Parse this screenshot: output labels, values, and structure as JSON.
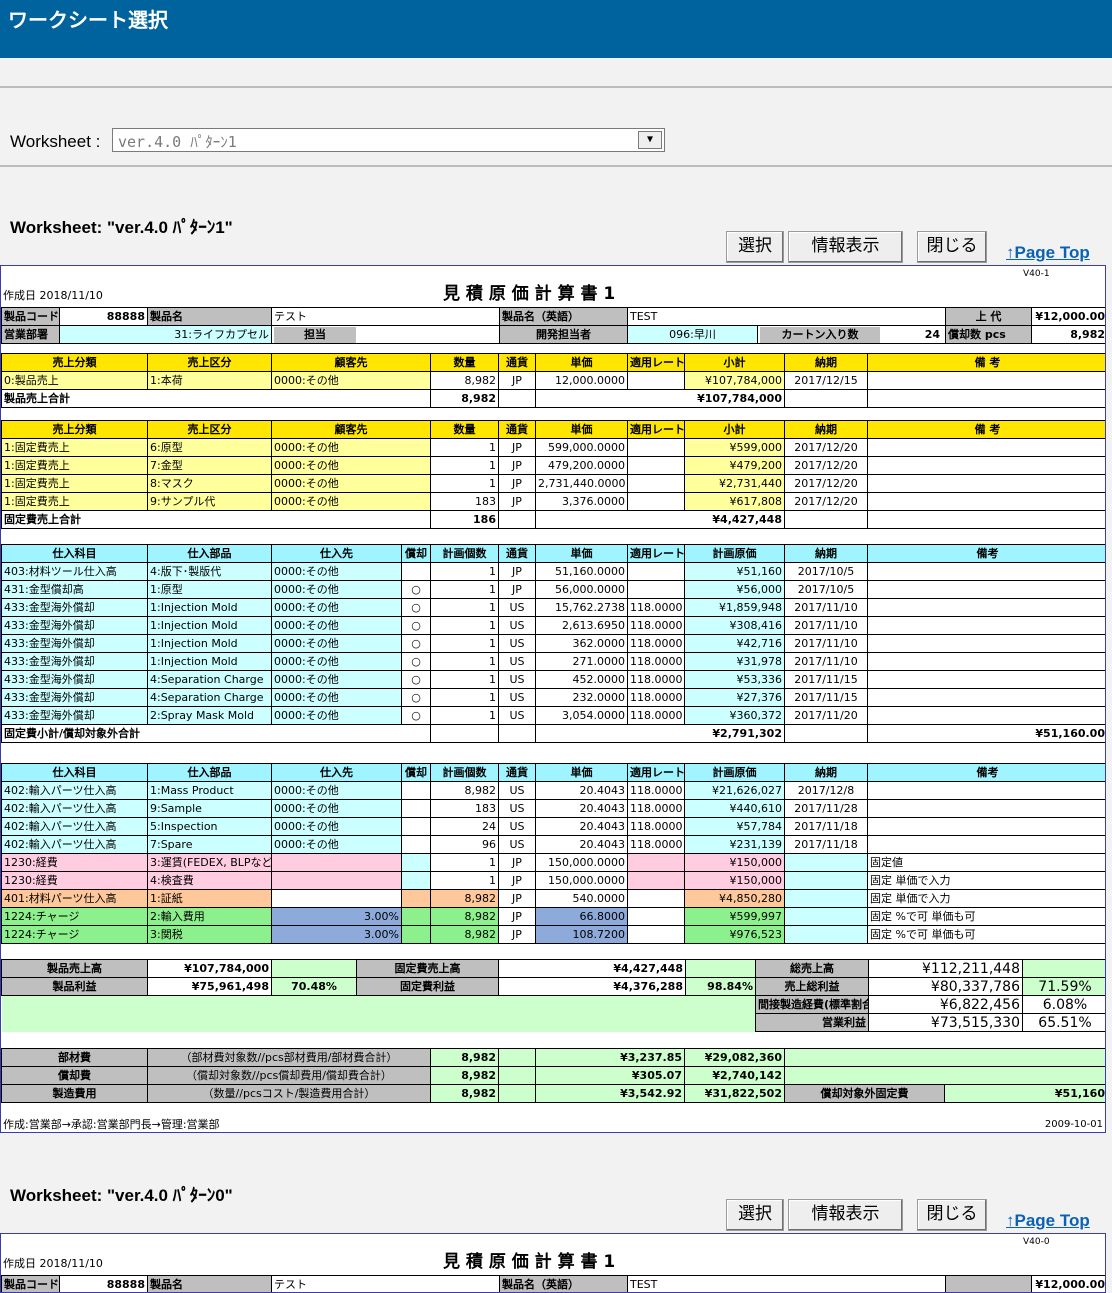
{
  "window": {
    "title": "ワークシート選択"
  },
  "selector": {
    "label": "Worksheet :",
    "value": "ver.4.0 ﾊﾟﾀｰﾝ1"
  },
  "buttons": {
    "select": "選択",
    "info": "情報表示",
    "close": "閉じる",
    "pagetop": "↑Page Top"
  },
  "ws1": {
    "title": "Worksheet: \"ver.4.0 ﾊﾟﾀｰﾝ1\"",
    "version": "V40-1"
  },
  "ws2": {
    "title": "Worksheet: \"ver.4.0 ﾊﾟﾀｰﾝ0\"",
    "version": "V40-0"
  },
  "doc": {
    "date": "作成日 2018/11/10",
    "title": "見 積 原 価 計 算 書 1",
    "info": {
      "code_label": "製品コード",
      "code": "88888",
      "name_label": "製品名",
      "name": "テスト",
      "ename_label": "製品名（英語）",
      "ename": "TEST",
      "price_label": "上 代",
      "price": "¥12,000.00",
      "dept_label": "営業部署",
      "dept": "31:ライフカプセル",
      "staff_label": "担当",
      "staff": "",
      "dev_label": "開発担当者",
      "dev": "096:早川",
      "carton_label": "カートン入り数",
      "carton": "24",
      "depr_label": "償却数 pcs",
      "depr": "8,982"
    },
    "sales_header": [
      "売上分類",
      "売上区分",
      "顧客先",
      "数量",
      "通貨",
      "単価",
      "適用レート",
      "小計",
      "納期",
      "備 考"
    ],
    "sales1": [
      [
        "0:製品売上",
        "1:本荷",
        "0000:その他",
        "8,982",
        "JP",
        "12,000.0000",
        "",
        "¥107,784,000",
        "2017/12/15",
        ""
      ]
    ],
    "sales1_total": {
      "label": "製品売上合計",
      "qty": "8,982",
      "amount": "¥107,784,000"
    },
    "sales2": [
      [
        "1:固定費売上",
        "6:原型",
        "0000:その他",
        "1",
        "JP",
        "599,000.0000",
        "",
        "¥599,000",
        "2017/12/20",
        ""
      ],
      [
        "1:固定費売上",
        "7:金型",
        "0000:その他",
        "1",
        "JP",
        "479,200.0000",
        "",
        "¥479,200",
        "2017/12/20",
        ""
      ],
      [
        "1:固定費売上",
        "8:マスク",
        "0000:その他",
        "1",
        "JP",
        "2,731,440.0000",
        "",
        "¥2,731,440",
        "2017/12/20",
        ""
      ],
      [
        "1:固定費売上",
        "9:サンプル代",
        "0000:その他",
        "183",
        "JP",
        "3,376.0000",
        "",
        "¥617,808",
        "2017/12/20",
        ""
      ]
    ],
    "sales2_total": {
      "label": "固定費売上合計",
      "qty": "186",
      "amount": "¥4,427,448"
    },
    "purch_header": [
      "仕入科目",
      "仕入部品",
      "仕入先",
      "償却",
      "計画個数",
      "通貨",
      "単価",
      "適用レート",
      "計画原価",
      "納期",
      "備考"
    ],
    "purch1": [
      [
        "403:材料ツール仕入高",
        "4:版下･製版代",
        "0000:その他",
        "",
        "1",
        "JP",
        "51,160.0000",
        "",
        "¥51,160",
        "2017/10/5",
        ""
      ],
      [
        "431:金型償却高",
        "1:原型",
        "0000:その他",
        "○",
        "1",
        "JP",
        "56,000.0000",
        "",
        "¥56,000",
        "2017/10/5",
        ""
      ],
      [
        "433:金型海外償却",
        "1:Injection Mold",
        "0000:その他",
        "○",
        "1",
        "US",
        "15,762.2738",
        "118.0000",
        "¥1,859,948",
        "2017/11/10",
        ""
      ],
      [
        "433:金型海外償却",
        "1:Injection Mold",
        "0000:その他",
        "○",
        "1",
        "US",
        "2,613.6950",
        "118.0000",
        "¥308,416",
        "2017/11/10",
        ""
      ],
      [
        "433:金型海外償却",
        "1:Injection Mold",
        "0000:その他",
        "○",
        "1",
        "US",
        "362.0000",
        "118.0000",
        "¥42,716",
        "2017/11/10",
        ""
      ],
      [
        "433:金型海外償却",
        "1:Injection Mold",
        "0000:その他",
        "○",
        "1",
        "US",
        "271.0000",
        "118.0000",
        "¥31,978",
        "2017/11/10",
        ""
      ],
      [
        "433:金型海外償却",
        "4:Separation Charge",
        "0000:その他",
        "○",
        "1",
        "US",
        "452.0000",
        "118.0000",
        "¥53,336",
        "2017/11/15",
        ""
      ],
      [
        "433:金型海外償却",
        "4:Separation Charge",
        "0000:その他",
        "○",
        "1",
        "US",
        "232.0000",
        "118.0000",
        "¥27,376",
        "2017/11/15",
        ""
      ],
      [
        "433:金型海外償却",
        "2:Spray Mask Mold",
        "0000:その他",
        "○",
        "1",
        "US",
        "3,054.0000",
        "118.0000",
        "¥360,372",
        "2017/11/20",
        ""
      ]
    ],
    "purch1_total": {
      "label": "固定費小計/償却対象外合計",
      "amount": "¥2,791,302",
      "other": "¥51,160.00"
    },
    "purch2": [
      [
        "402:輸入パーツ仕入高",
        "1:Mass Product",
        "0000:その他",
        "",
        "8,982",
        "US",
        "20.4043",
        "118.0000",
        "¥21,626,027",
        "2017/12/8",
        ""
      ],
      [
        "402:輸入パーツ仕入高",
        "9:Sample",
        "0000:その他",
        "",
        "183",
        "US",
        "20.4043",
        "118.0000",
        "¥440,610",
        "2017/11/28",
        ""
      ],
      [
        "402:輸入パーツ仕入高",
        "5:Inspection",
        "0000:その他",
        "",
        "24",
        "US",
        "20.4043",
        "118.0000",
        "¥57,784",
        "2017/11/18",
        ""
      ],
      [
        "402:輸入パーツ仕入高",
        "7:Spare",
        "0000:その他",
        "",
        "96",
        "US",
        "20.4043",
        "118.0000",
        "¥231,139",
        "2017/11/18",
        ""
      ],
      [
        "1230:経費",
        "3:運賃(FEDEX, BLPなど",
        "",
        "",
        "1",
        "JP",
        "150,000.0000",
        "",
        "¥150,000",
        "",
        "固定値"
      ],
      [
        "1230:経費",
        "4:検査費",
        "",
        "",
        "1",
        "JP",
        "150,000.0000",
        "",
        "¥150,000",
        "",
        "固定 単価で入力"
      ],
      [
        "401:材料パーツ仕入高",
        "1:証紙",
        "",
        "",
        "8,982",
        "JP",
        "540.0000",
        "",
        "¥4,850,280",
        "",
        "固定 単価で入力"
      ],
      [
        "1224:チャージ",
        "2:輸入費用",
        "3.00%",
        "",
        "8,982",
        "JP",
        "66.8000",
        "",
        "¥599,997",
        "",
        "固定 %で可 単価も可"
      ],
      [
        "1224:チャージ",
        "3:関税",
        "3.00%",
        "",
        "8,982",
        "JP",
        "108.7200",
        "",
        "¥976,523",
        "",
        "固定 %で可 単価も可"
      ]
    ],
    "summary": {
      "prod_sales_label": "製品売上高",
      "prod_sales": "¥107,784,000",
      "fixed_sales_label": "固定費売上高",
      "fixed_sales": "¥4,427,448",
      "total_sales_label": "総売上高",
      "total_sales": "¥112,211,448",
      "prod_profit_label": "製品利益",
      "prod_profit": "¥75,961,498",
      "prod_profit_pct": "70.48%",
      "fixed_profit_label": "固定費利益",
      "fixed_profit": "¥4,376,288",
      "fixed_profit_pct": "98.84%",
      "gross_label": "売上総利益",
      "gross": "¥80,337,786",
      "gross_pct": "71.59%",
      "indirect_label": "間接製造経費(標準割合)",
      "indirect": "¥6,822,456",
      "indirect_pct": "6.08%",
      "op_label": "営業利益",
      "op": "¥73,515,330",
      "op_pct": "65.51%"
    },
    "costs": [
      {
        "label": "部材費",
        "desc": "（部材費対象数//pcs部材費用/部材費合計）",
        "qty": "8,982",
        "unit": "¥3,237.85",
        "total": "¥29,082,360"
      },
      {
        "label": "償却費",
        "desc": "（償却対象数//pcs償却費用/償却費合計）",
        "qty": "8,982",
        "unit": "¥305.07",
        "total": "¥2,740,142"
      },
      {
        "label": "製造費用",
        "desc": "（数量//pcsコスト/製造費用合計）",
        "qty": "8,982",
        "unit": "¥3,542.92",
        "total": "¥31,822,502"
      }
    ],
    "fixed_excl_label": "償却対象外固定費",
    "fixed_excl": "¥51,160",
    "footer": "作成:営業部→承認:営業部門長→管理:営業部",
    "footer_date": "2009-10-01"
  },
  "doc2": {
    "date": "作成日 2018/11/10",
    "title": "見 積 原 価 計 算 書 1",
    "code_label": "製品コード",
    "code": "88888",
    "name_label": "製品名",
    "name": "テスト",
    "ename_label": "製品名（英語）",
    "ename": "TEST",
    "price": "¥12,000.00"
  }
}
